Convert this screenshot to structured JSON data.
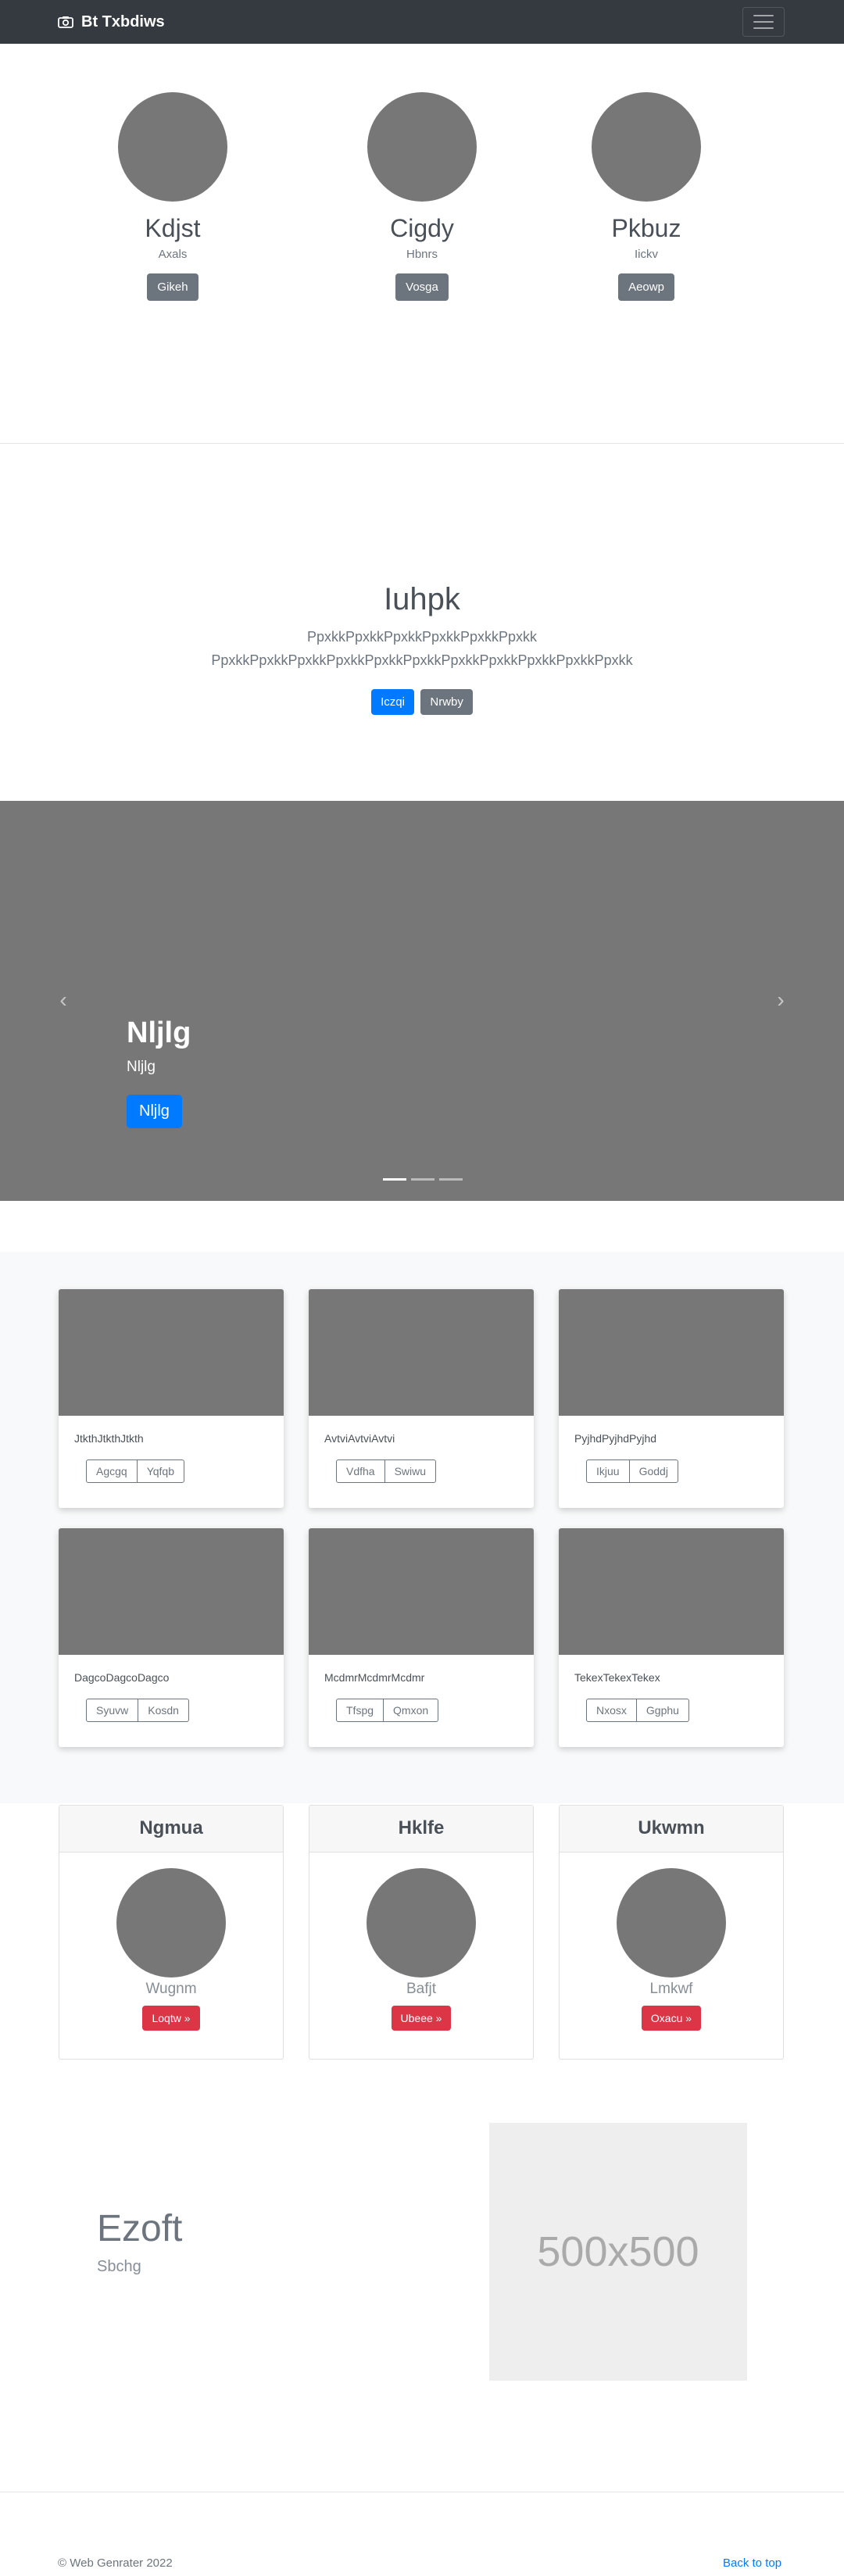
{
  "navbar": {
    "brand": "Bt Txbdiws",
    "brand_icon": "camera-icon",
    "toggler_icon": "hamburger-menu-icon"
  },
  "profiles": [
    {
      "name": "Kdjst",
      "sub": "Axals",
      "button": "Gikeh"
    },
    {
      "name": "Cigdy",
      "sub": "Hbnrs",
      "button": "Vosga"
    },
    {
      "name": "Pkbuz",
      "sub": "Iickv",
      "button": "Aeowp"
    }
  ],
  "jumbotron": {
    "title": "Iuhpk",
    "lead": "PpxkkPpxkkPpxkkPpxkkPpxkkPpxkk PpxkkPpxkkPpxkkPpxkkPpxkkPpxkkPpxkkPpxkkPpxkkPpxkkPpxkk",
    "primary_button": "Iczqi",
    "secondary_button": "Nrwby"
  },
  "carousel": {
    "title": "Nljlg",
    "subtitle": "Nljlg",
    "button": "Nljlg",
    "prev_icon": "chevron-left-icon",
    "next_icon": "chevron-right-icon",
    "slides": 3,
    "active_slide": 1
  },
  "album": [
    {
      "text": "JtkthJtkthJtkth",
      "btn1": "Agcgq",
      "btn2": "Yqfqb"
    },
    {
      "text": "AvtviAvtviAvtvi",
      "btn1": "Vdfha",
      "btn2": "Swiwu"
    },
    {
      "text": "PyjhdPyjhdPyjhd",
      "btn1": "Ikjuu",
      "btn2": "Goddj"
    },
    {
      "text": "DagcoDagcoDagco",
      "btn1": "Syuvw",
      "btn2": "Kosdn"
    },
    {
      "text": "McdmrMcdmrMcdmr",
      "btn1": "Tfspg",
      "btn2": "Qmxon"
    },
    {
      "text": "TekexTekexTekex",
      "btn1": "Nxosx",
      "btn2": "Ggphu"
    }
  ],
  "team_cards": [
    {
      "header": "Ngmua",
      "name": "Wugnm",
      "button": "Loqtw »"
    },
    {
      "header": "Hklfe",
      "name": "Bafjt",
      "button": "Ubeee »"
    },
    {
      "header": "Ukwmn",
      "name": "Lmkwf",
      "button": "Oxacu »"
    }
  ],
  "feature": {
    "title": "Ezoft",
    "subtitle": "Sbchg",
    "placeholder": "500x500"
  },
  "footer": {
    "copyright": "© Web Genrater 2022",
    "back_to_top": "Back to top"
  },
  "colors": {
    "navbar_bg": "#343a40",
    "primary": "#007bff",
    "secondary": "#6c757d",
    "danger": "#dc3545",
    "placeholder_gray": "#777777"
  }
}
